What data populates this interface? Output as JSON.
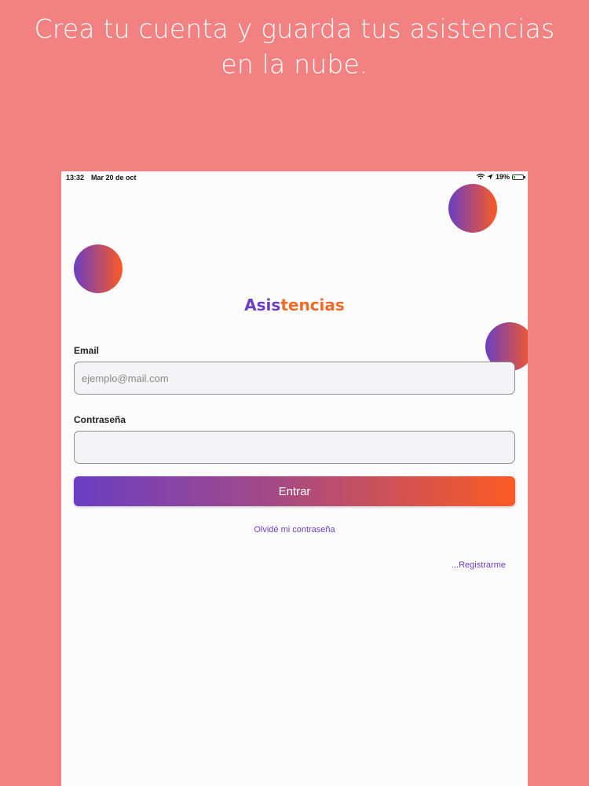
{
  "headline": {
    "line1": "Crea tu cuenta y guarda tus asistencias",
    "line2": "en la nube."
  },
  "status_bar": {
    "time": "13:32",
    "date": "Mar 20 de oct",
    "battery_percent": "19%",
    "battery_level": 0.19,
    "icons": [
      "wifi-icon",
      "location-arrow-icon",
      "battery-charging-icon"
    ]
  },
  "app": {
    "title_part1": "Asis",
    "title_part2": "tencias",
    "title_part3": "",
    "colors": {
      "primary": "#6a3ec2",
      "accent": "#fb5a24",
      "background": "#f28282"
    }
  },
  "form": {
    "email_label": "Email",
    "email_placeholder": "ejemplo@mail.com",
    "email_value": "",
    "password_label": "Contraseña",
    "password_value": "",
    "submit_label": "Entrar"
  },
  "links": {
    "forgot_password": "Olvidé mi contraseña",
    "register": "...Registrarme"
  }
}
